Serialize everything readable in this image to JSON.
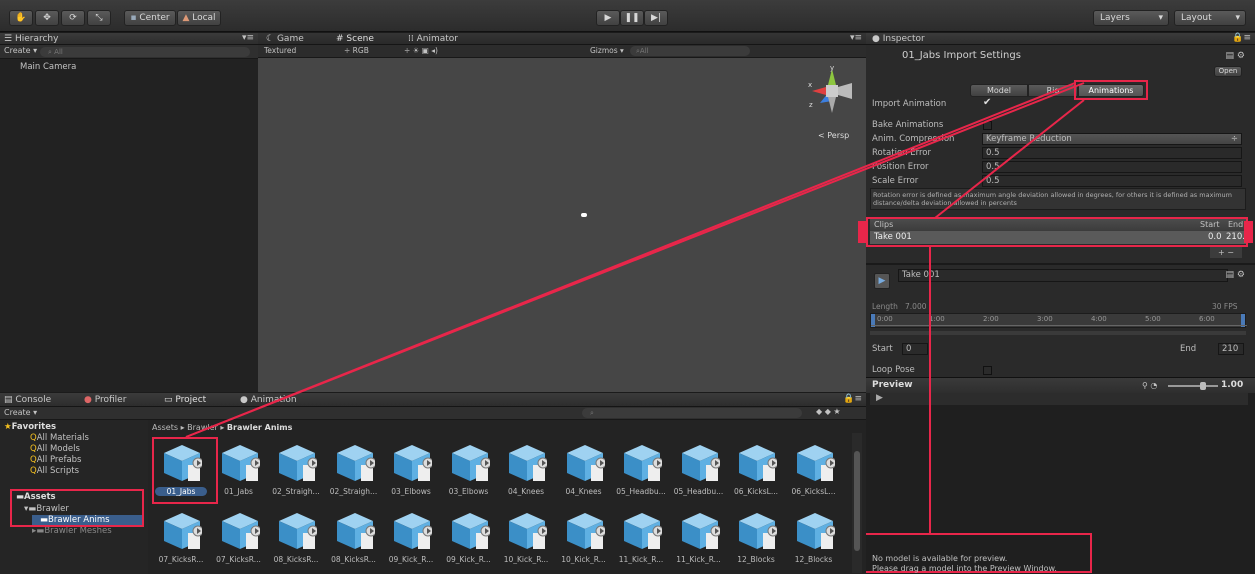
{
  "toolbar": {
    "center_label": "Center",
    "local_label": "Local",
    "layers_label": "Layers",
    "layout_label": "Layout"
  },
  "hierarchy": {
    "tab_label": "Hierarchy",
    "create_label": "Create",
    "search_placeholder": "All",
    "items": [
      "Main Camera"
    ]
  },
  "scene": {
    "tabs": [
      "Game",
      "Scene",
      "Animator"
    ],
    "shading_mode": "Textured",
    "render_mode": "RGB",
    "gizmos_label": "Gizmos",
    "gizmos_search": "All",
    "persp_label": "Persp"
  },
  "inspector": {
    "tab_label": "Inspector",
    "title": "01_Jabs Import Settings",
    "open_label": "Open",
    "tabs": [
      "Model",
      "Rig",
      "Animations"
    ],
    "import_animation_label": "Import Animation",
    "bake_animations_label": "Bake Animations",
    "anim_compression_label": "Anim. Compression",
    "anim_compression_value": "Keyframe Reduction",
    "rotation_error_label": "Rotation Error",
    "rotation_error_value": "0.5",
    "position_error_label": "Position Error",
    "position_error_value": "0.5",
    "scale_error_label": "Scale Error",
    "scale_error_value": "0.5",
    "help_text": "Rotation error is defined as maximum angle deviation allowed in degrees, for others it is defined as maximum distance/delta deviation allowed in percents",
    "clips_header": "Clips",
    "start_header": "Start",
    "end_header": "End",
    "clip_name": "Take 001",
    "clip_start": "0.0",
    "clip_end": "210.0",
    "clip_title": "Take 001",
    "length_label": "Length",
    "length_value": "7.000",
    "fps_label": "30 FPS",
    "timeline_ticks": [
      "0:00",
      "1:00",
      "2:00",
      "3:00",
      "4:00",
      "5:00",
      "6:00"
    ],
    "start_label": "Start",
    "start_value": "0",
    "end_label": "End",
    "end_value": "210",
    "loop_pose_label": "Loop Pose",
    "preview_label": "Preview",
    "preview_speed": "1.00",
    "no_model_line1": "No model is available for preview.",
    "no_model_line2": "Please drag a model into the Preview Window."
  },
  "bottom": {
    "tabs": [
      "Console",
      "Profiler",
      "Project",
      "Animation"
    ],
    "create_label": "Create",
    "favorites_label": "Favorites",
    "favorites": [
      "All Materials",
      "All Models",
      "All Prefabs",
      "All Scripts"
    ],
    "assets_label": "Assets",
    "folders": [
      "Brawler",
      "Brawler Anims",
      "Brawler Meshes"
    ],
    "breadcrumb": [
      "Assets",
      "Brawler",
      "Brawler Anims"
    ],
    "row1_assets": [
      "01_Jabs",
      "01_Jabs",
      "02_Straigh...",
      "02_Straigh...",
      "03_Elbows",
      "03_Elbows",
      "04_Knees",
      "04_Knees",
      "05_Headbu...",
      "05_Headbu...",
      "06_KicksL...",
      "06_KicksL..."
    ],
    "row2_assets": [
      "07_KicksR...",
      "07_KicksR...",
      "08_KicksR...",
      "08_KicksR...",
      "09_Kick_R...",
      "09_Kick_R...",
      "10_Kick_R...",
      "10_Kick_R...",
      "11_Kick_R...",
      "11_Kick_R...",
      "12_Blocks",
      "12_Blocks"
    ]
  },
  "colors": {
    "highlight": "#e8264a",
    "panel_bg": "#232323",
    "scene_bg": "#464646",
    "selection": "#3a5e8c",
    "cube_light": "#9fd2f1",
    "cube_dark": "#3b8fc7"
  }
}
